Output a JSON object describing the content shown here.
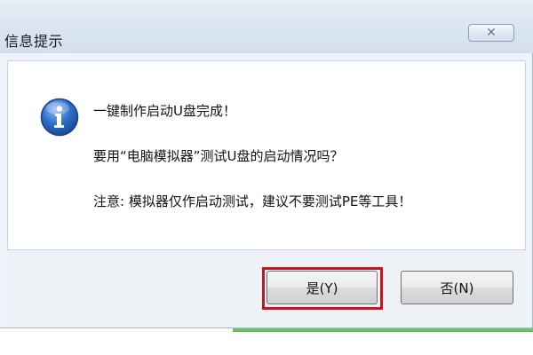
{
  "dialog": {
    "title": "信息提示",
    "close_symbol": "✕",
    "icon": "info-icon",
    "messages": [
      "一键制作启动U盘完成！",
      "要用“电脑模拟器”测试U盘的启动情况吗？",
      "注意: 模拟器仅作启动测试，建议不要测试PE等工具！"
    ],
    "buttons": {
      "yes_label": "是(Y)",
      "no_label": "否(N)"
    }
  },
  "colors": {
    "highlight": "#c8141c",
    "icon_blue": "#2f6fc9"
  }
}
